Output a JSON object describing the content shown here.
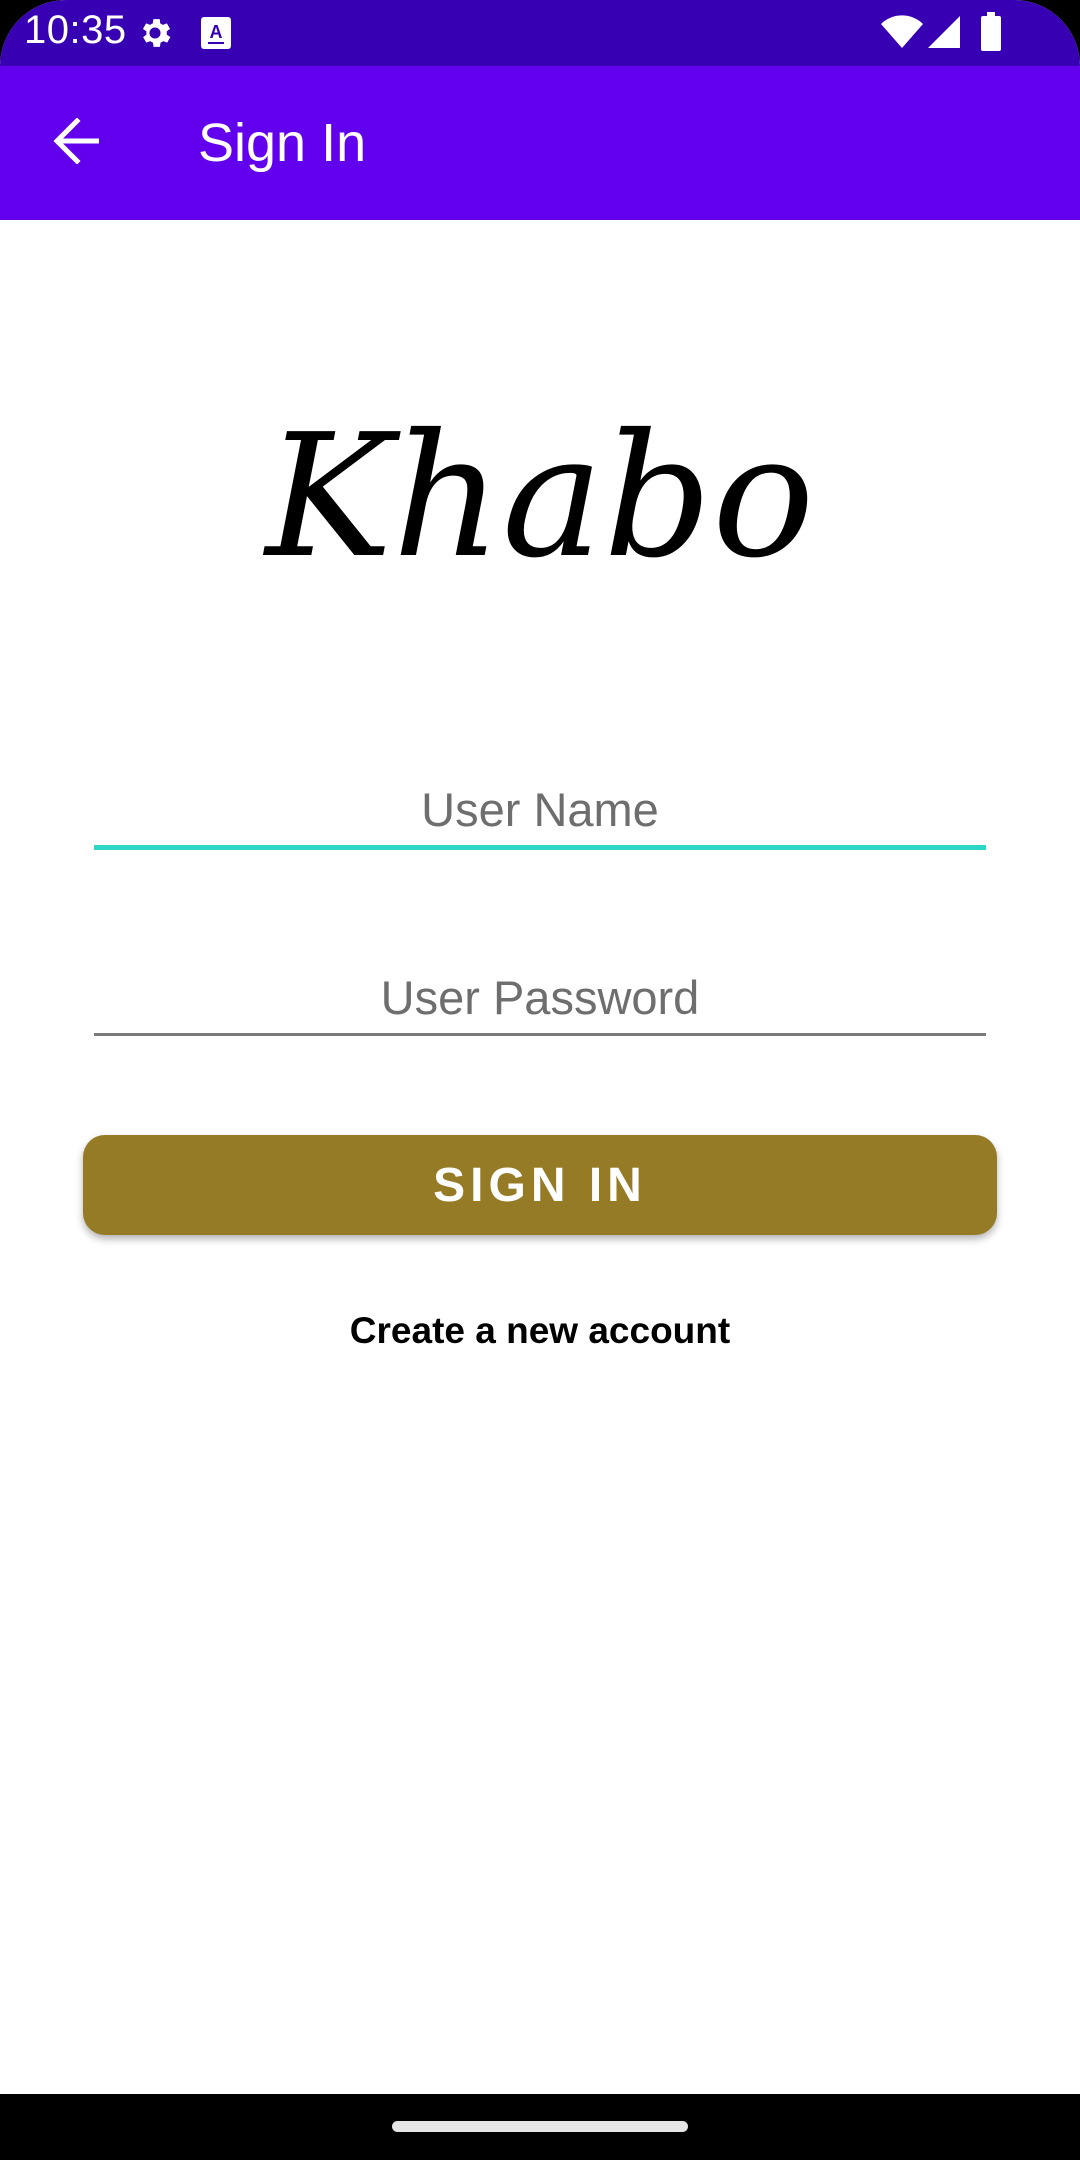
{
  "status_bar": {
    "time": "10:35",
    "icons": [
      "settings-icon",
      "text-a-icon",
      "wifi-icon",
      "signal-icon",
      "battery-icon"
    ]
  },
  "app_bar": {
    "title": "Sign In",
    "back_icon": "arrow-left-icon"
  },
  "logo": {
    "text": "Khabo"
  },
  "form": {
    "username": {
      "placeholder": "User Name",
      "value": ""
    },
    "password": {
      "placeholder": "User Password",
      "value": ""
    },
    "signin_label": "SIGN IN",
    "create_account_label": "Create a new account"
  },
  "colors": {
    "status_bar": "#3700B3",
    "app_bar": "#6200EE",
    "signin_button": "#967B26",
    "focused_underline": "#2ED6C6"
  }
}
